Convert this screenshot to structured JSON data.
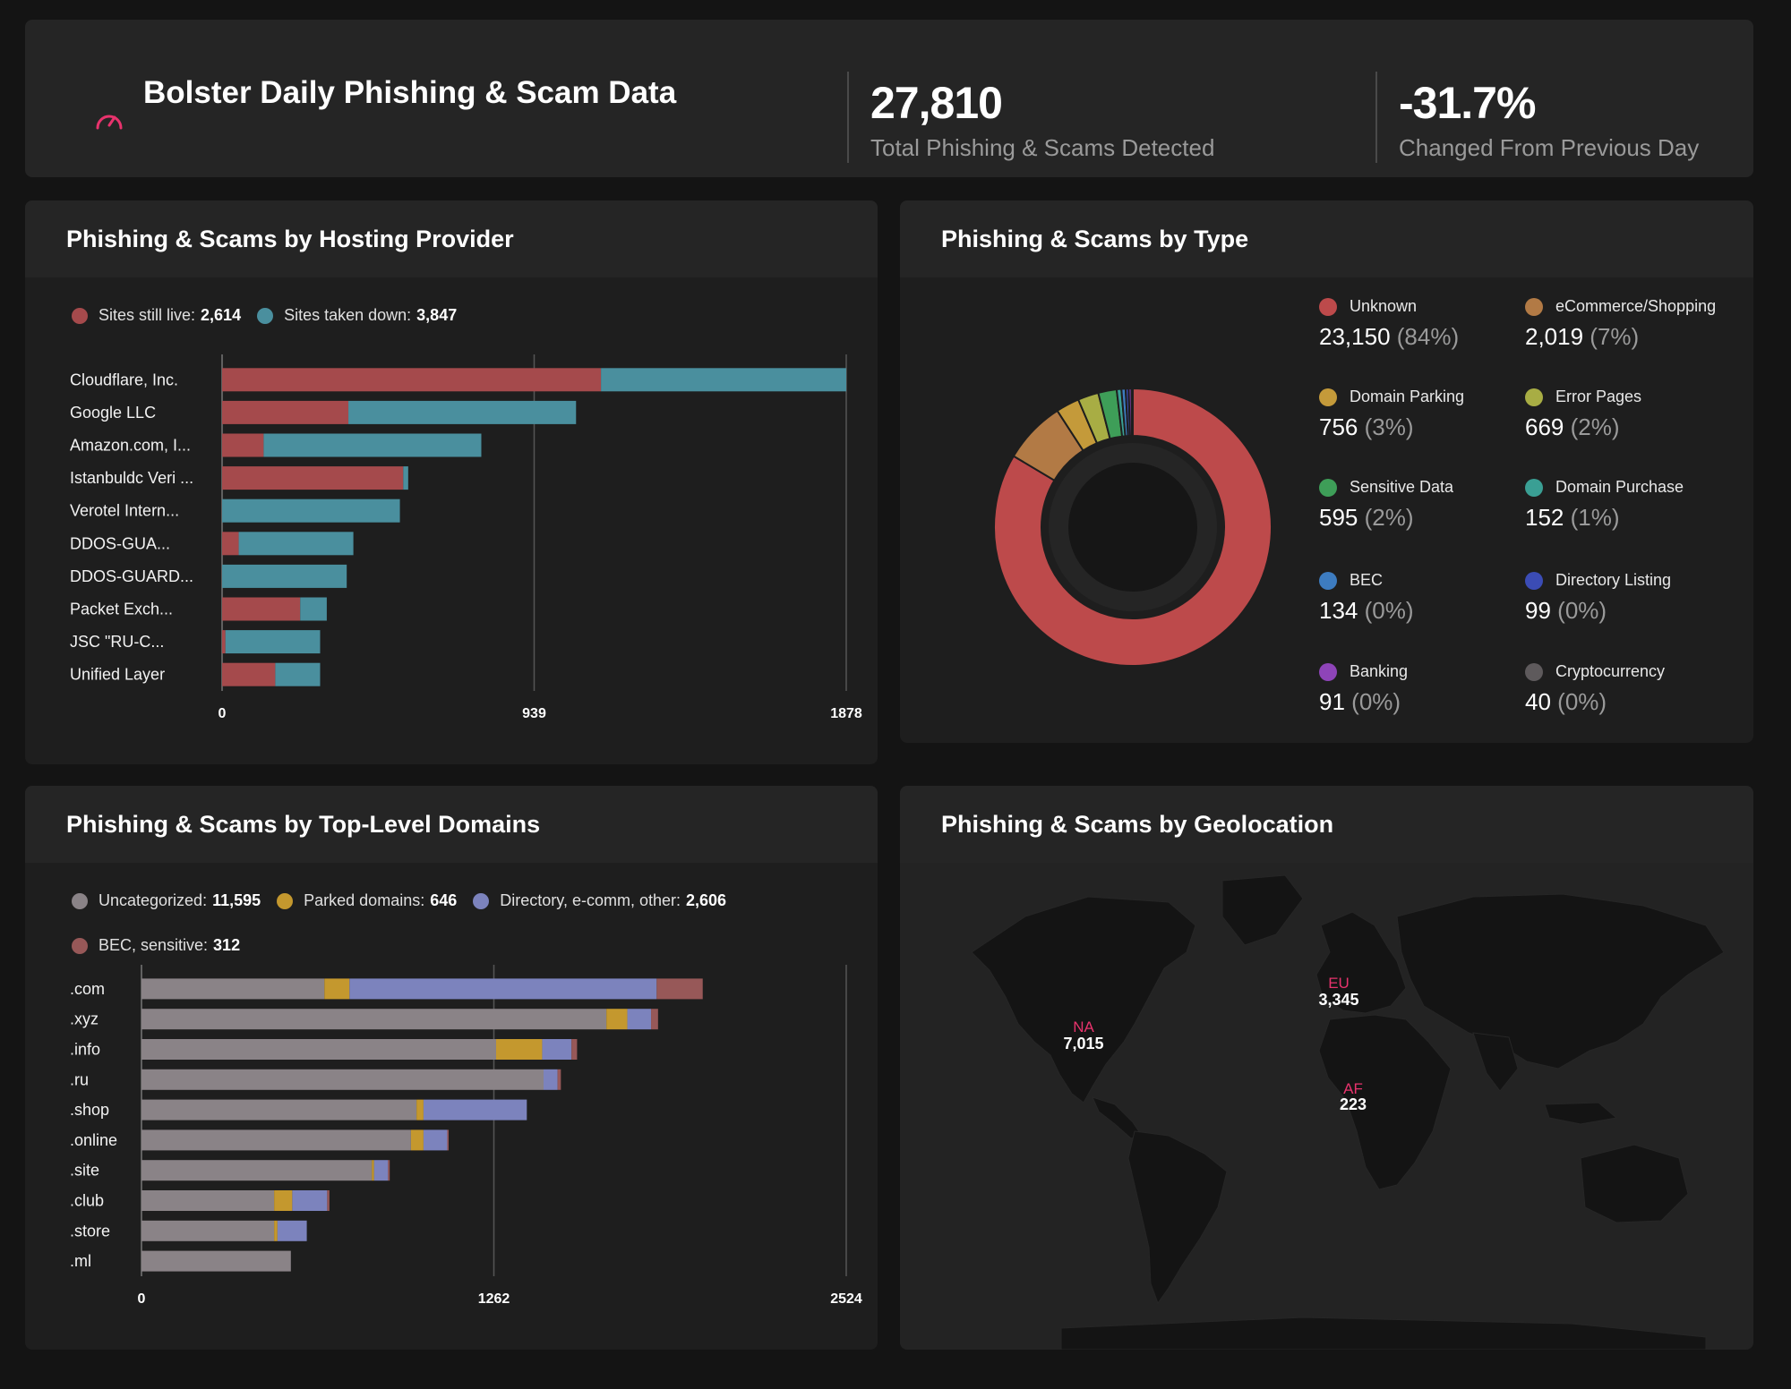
{
  "header": {
    "title": "Bolster Daily Phishing & Scam Data",
    "total_value": "27,810",
    "total_label": "Total Phishing & Scams Detected",
    "change_value": "-31.7%",
    "change_label": "Changed From Previous Day"
  },
  "hosting": {
    "title": "Phishing & Scams by Hosting Provider",
    "legend": [
      {
        "label": "Sites still live:",
        "value": "2,614",
        "color": "#a54a4c"
      },
      {
        "label": "Sites taken down:",
        "value": "3,847",
        "color": "#4a8f9e"
      }
    ]
  },
  "types": {
    "title": "Phishing & Scams by Type",
    "items": [
      {
        "name": "Unknown",
        "value": "23,150",
        "pct": "(84%)",
        "color": "#bd4a4b"
      },
      {
        "name": "eCommerce/Shopping",
        "value": "2,019",
        "pct": "(7%)",
        "color": "#b27a45"
      },
      {
        "name": "Domain Parking",
        "value": "756",
        "pct": "(3%)",
        "color": "#c49a3a"
      },
      {
        "name": "Error Pages",
        "value": "669",
        "pct": "(2%)",
        "color": "#a8ad44"
      },
      {
        "name": "Sensitive Data",
        "value": "595",
        "pct": "(2%)",
        "color": "#3e9e58"
      },
      {
        "name": "Domain Purchase",
        "value": "152",
        "pct": "(1%)",
        "color": "#3a9f94"
      },
      {
        "name": "BEC",
        "value": "134",
        "pct": "(0%)",
        "color": "#3d7cc0"
      },
      {
        "name": "Directory Listing",
        "value": "99",
        "pct": "(0%)",
        "color": "#3b4cb5"
      },
      {
        "name": "Banking",
        "value": "91",
        "pct": "(0%)",
        "color": "#8e44b8"
      },
      {
        "name": "Cryptocurrency",
        "value": "40",
        "pct": "(0%)",
        "color": "#5e5a5c"
      }
    ]
  },
  "tld": {
    "title": "Phishing & Scams by Top-Level Domains",
    "legend": [
      {
        "label": "Uncategorized:",
        "value": "11,595",
        "color": "#8a8387"
      },
      {
        "label": "Parked domains:",
        "value": "646",
        "color": "#c4982e"
      },
      {
        "label": "Directory, e-comm, other:",
        "value": "2,606",
        "color": "#7c83bd"
      },
      {
        "label": "BEC, sensitive:",
        "value": "312",
        "color": "#975858"
      }
    ]
  },
  "geo": {
    "title": "Phishing & Scams by Geolocation",
    "regions": [
      {
        "code": "NA",
        "value": "7,015"
      },
      {
        "code": "EU",
        "value": "3,345"
      },
      {
        "code": "AF",
        "value": "223"
      }
    ]
  },
  "chart_data": [
    {
      "type": "bar",
      "orientation": "horizontal",
      "stacked": true,
      "title": "Phishing & Scams by Hosting Provider",
      "categories": [
        "Cloudflare, Inc.",
        "Google LLC",
        "Amazon.com, I...",
        "Istanbuldc Veri ...",
        "Verotel Intern...",
        "DDOS-GUA...",
        "DDOS-GUARD...",
        "Packet Exch...",
        "JSC \"RU-C...",
        "Unified Layer"
      ],
      "series": [
        {
          "name": "Sites still live",
          "color": "#a54a4c",
          "values": [
            1140,
            380,
            125,
            545,
            0,
            50,
            0,
            235,
            10,
            160
          ]
        },
        {
          "name": "Sites taken down",
          "color": "#4a8f9e",
          "values": [
            738,
            685,
            655,
            15,
            535,
            345,
            375,
            80,
            285,
            135
          ]
        }
      ],
      "xticks": [
        "0",
        "939",
        "1878"
      ],
      "xlim": [
        0,
        1878
      ],
      "legend_position": "top"
    },
    {
      "type": "pie",
      "donut": true,
      "title": "Phishing & Scams by Type",
      "labels": [
        "Unknown",
        "eCommerce/Shopping",
        "Domain Parking",
        "Error Pages",
        "Sensitive Data",
        "Domain Purchase",
        "BEC",
        "Directory Listing",
        "Banking",
        "Cryptocurrency"
      ],
      "values": [
        23150,
        2019,
        756,
        669,
        595,
        152,
        134,
        99,
        91,
        40
      ],
      "colors": [
        "#bd4a4b",
        "#b27a45",
        "#c49a3a",
        "#a8ad44",
        "#3e9e58",
        "#3a9f94",
        "#3d7cc0",
        "#3b4cb5",
        "#8e44b8",
        "#5e5a5c"
      ],
      "legend_position": "right"
    },
    {
      "type": "bar",
      "orientation": "horizontal",
      "stacked": true,
      "title": "Phishing & Scams by Top-Level Domains",
      "categories": [
        ".com",
        ".xyz",
        ".info",
        ".ru",
        ".shop",
        ".online",
        ".site",
        ".club",
        ".store",
        ".ml"
      ],
      "series": [
        {
          "name": "Uncategorized",
          "color": "#8a8387",
          "values": [
            655,
            1665,
            1270,
            1440,
            985,
            965,
            825,
            475,
            475,
            535
          ]
        },
        {
          "name": "Parked domains",
          "color": "#c4982e",
          "values": [
            90,
            75,
            165,
            0,
            25,
            45,
            8,
            65,
            12,
            0
          ]
        },
        {
          "name": "Directory, e-comm, other",
          "color": "#7c83bd",
          "values": [
            1100,
            85,
            105,
            50,
            370,
            85,
            50,
            125,
            105,
            0
          ]
        },
        {
          "name": "BEC, sensitive",
          "color": "#975858",
          "values": [
            165,
            25,
            20,
            12,
            0,
            5,
            6,
            8,
            0,
            0
          ]
        }
      ],
      "xticks": [
        "0",
        "1262",
        "2524"
      ],
      "xlim": [
        0,
        2524
      ],
      "legend_position": "top"
    }
  ]
}
